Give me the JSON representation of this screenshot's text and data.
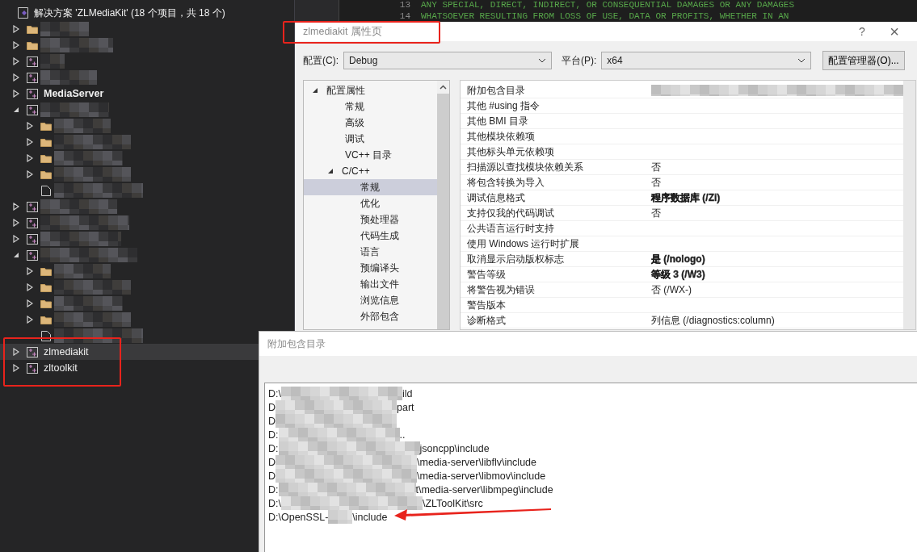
{
  "solution_explorer": {
    "title": "解决方案 'ZLMediaKit' (18 个项目，共 18 个)",
    "items": [
      {
        "kind": "folder",
        "expanded": false,
        "masked": true,
        "selected": false
      },
      {
        "kind": "folder",
        "expanded": false,
        "masked": true,
        "selected": false
      },
      {
        "kind": "project",
        "expanded": false,
        "masked": true,
        "selected": false
      },
      {
        "kind": "project",
        "expanded": false,
        "masked": true,
        "selected": false
      },
      {
        "kind": "project",
        "expanded": false,
        "label": "MediaServer",
        "bold": true,
        "selected": false
      },
      {
        "kind": "project",
        "expanded": true,
        "masked": true,
        "selected": false,
        "children": [
          {
            "kind": "folder",
            "expanded": false,
            "masked": true,
            "selected": false
          },
          {
            "kind": "folder",
            "expanded": false,
            "masked": true,
            "selected": false
          },
          {
            "kind": "folder",
            "expanded": false,
            "masked": true,
            "selected": false
          },
          {
            "kind": "folder",
            "expanded": false,
            "masked": true,
            "selected": false
          },
          {
            "kind": "file",
            "masked": true,
            "selected": false
          }
        ]
      },
      {
        "kind": "project",
        "expanded": false,
        "masked": true,
        "selected": false
      },
      {
        "kind": "project",
        "expanded": false,
        "masked": true,
        "selected": false
      },
      {
        "kind": "project",
        "expanded": false,
        "masked": true,
        "selected": false
      },
      {
        "kind": "project",
        "expanded": true,
        "masked": true,
        "selected": false,
        "children": [
          {
            "kind": "folder",
            "expanded": false,
            "masked": true,
            "selected": false
          },
          {
            "kind": "folder",
            "expanded": false,
            "masked": true,
            "selected": false
          },
          {
            "kind": "folder",
            "expanded": false,
            "masked": true,
            "selected": false
          },
          {
            "kind": "folder",
            "expanded": false,
            "masked": true,
            "selected": false
          },
          {
            "kind": "file",
            "masked": true,
            "selected": false
          }
        ]
      },
      {
        "kind": "project",
        "expanded": false,
        "label": "zlmediakit",
        "bold": false,
        "selected": true
      },
      {
        "kind": "project",
        "expanded": false,
        "label": "zltoolkit",
        "bold": false,
        "selected": false
      }
    ]
  },
  "editor": {
    "lines": [
      {
        "number": "13",
        "text": "ANY SPECIAL, DIRECT, INDIRECT, OR CONSEQUENTIAL DAMAGES OR ANY DAMAGES"
      },
      {
        "number": "14",
        "text": "WHATSOEVER RESULTING FROM LOSS OF USE, DATA OR PROFITS, WHETHER IN AN"
      }
    ]
  },
  "property_dialog": {
    "title": "zlmediakit 属性页",
    "help": "?",
    "close": "×",
    "configuration": {
      "label": "配置(C):",
      "value": "Debug"
    },
    "platform": {
      "label": "平台(P):",
      "value": "x64"
    },
    "manager_button": "配置管理器(O)...",
    "tree": [
      {
        "label": "配置属性",
        "expanded": true,
        "selected": false,
        "children": [
          {
            "label": "常规",
            "selected": false
          },
          {
            "label": "高级",
            "selected": false
          },
          {
            "label": "调试",
            "selected": false
          },
          {
            "label": "VC++ 目录",
            "selected": false
          },
          {
            "label": "C/C++",
            "expanded": true,
            "selected": false,
            "children": [
              {
                "label": "常规",
                "selected": true
              },
              {
                "label": "优化",
                "selected": false
              },
              {
                "label": "预处理器",
                "selected": false
              },
              {
                "label": "代码生成",
                "selected": false
              },
              {
                "label": "语言",
                "selected": false
              },
              {
                "label": "预编译头",
                "selected": false
              },
              {
                "label": "输出文件",
                "selected": false
              },
              {
                "label": "浏览信息",
                "selected": false
              },
              {
                "label": "外部包含",
                "selected": false
              }
            ]
          }
        ]
      }
    ],
    "properties": [
      {
        "label": "附加包含目录",
        "masked": true
      },
      {
        "label": "其他 #using 指令"
      },
      {
        "label": "其他 BMI 目录"
      },
      {
        "label": "其他模块依赖项"
      },
      {
        "label": "其他标头单元依赖项"
      },
      {
        "label": "扫描源以查找模块依赖关系",
        "value": "否",
        "bold": false
      },
      {
        "label": "将包含转换为导入",
        "value": "否",
        "bold": false
      },
      {
        "label": "调试信息格式",
        "value": "程序数据库 (/Zi)",
        "bold": true
      },
      {
        "label": "支持仅我的代码调试",
        "value": "否",
        "bold": false
      },
      {
        "label": "公共语言运行时支持"
      },
      {
        "label": "使用 Windows 运行时扩展"
      },
      {
        "label": "取消显示启动版权标志",
        "value": "是 (/nologo)",
        "bold": true
      },
      {
        "label": "警告等级",
        "value": "等级 3 (/W3)",
        "bold": true
      },
      {
        "label": "将警告视为错误",
        "value": "否 (/WX-)",
        "bold": false
      },
      {
        "label": "警告版本"
      },
      {
        "label": "诊断格式",
        "value": "列信息 (/diagnostics:column)",
        "bold": false
      }
    ]
  },
  "include_dialog": {
    "title": "附加包含目录",
    "lines": [
      {
        "prefix": "D:\\",
        "suffix": "ild"
      },
      {
        "prefix": "D",
        "suffix": "part"
      },
      {
        "prefix": "D"
      },
      {
        "prefix": "D:",
        "suffix": ".."
      },
      {
        "prefix": "D:",
        "suffix": "jsoncpp\\include"
      },
      {
        "prefix": "D",
        "suffix": "\\media-server\\libflv\\include"
      },
      {
        "prefix": "D",
        "suffix": "\\media-server\\libmov\\include"
      },
      {
        "prefix": "D:",
        "suffix": "t\\media-server\\libmpeg\\include"
      },
      {
        "prefix": "D:\\",
        "suffix": "\\ZLToolKit\\src"
      },
      {
        "prefix": "D:\\OpenSSL-",
        "suffix": "\\include"
      }
    ]
  }
}
